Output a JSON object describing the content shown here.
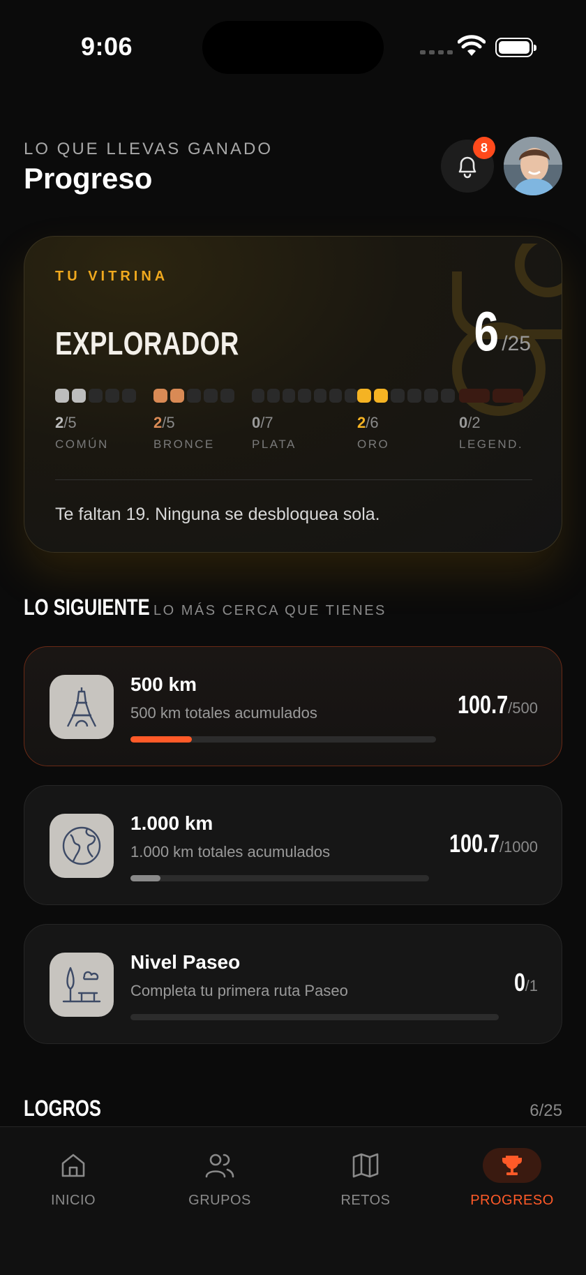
{
  "status_bar": {
    "time": "9:06"
  },
  "header": {
    "eyebrow": "LO QUE LLEVAS GANADO",
    "title": "Progreso",
    "notification_count": "8"
  },
  "vitrina": {
    "eyebrow": "TU VITRINA",
    "title": "EXPLORADOR",
    "count": "6",
    "total": "/25",
    "tiers": [
      {
        "got": "2",
        "max": "/5",
        "name": "COMÚN",
        "color": "#bdbdbd",
        "filled": 2,
        "dots": 5
      },
      {
        "got": "2",
        "max": "/5",
        "name": "BRONCE",
        "color": "#d98a55",
        "filled": 2,
        "dots": 5
      },
      {
        "got": "0",
        "max": "/7",
        "name": "PLATA",
        "color": "#cfcfcf",
        "filled": 0,
        "dots": 7
      },
      {
        "got": "2",
        "max": "/6",
        "name": "ORO",
        "color": "#f5b323",
        "filled": 2,
        "dots": 6
      },
      {
        "got": "0",
        "max": "/2",
        "name": "LEGEND.",
        "color": "#ff5a28",
        "filled": 0,
        "dots": 2
      }
    ],
    "footer": "Te faltan 19. Ninguna se desbloquea sola."
  },
  "siguiente": {
    "title": "LO SIGUIENTE",
    "subtitle": "LO MÁS CERCA QUE TIENES",
    "goals": [
      {
        "title": "500 km",
        "subtitle": "500 km totales acumulados",
        "value": "100.7",
        "max": "/500",
        "progress": 0.201,
        "icon": "eiffel-tower-icon",
        "active": true
      },
      {
        "title": "1.000 km",
        "subtitle": "1.000 km totales acumulados",
        "value": "100.7",
        "max": "/1000",
        "progress": 0.101,
        "icon": "globe-icon",
        "active": false
      },
      {
        "title": "Nivel Paseo",
        "subtitle": "Completa tu primera ruta Paseo",
        "value": "0",
        "max": "/1",
        "progress": 0,
        "icon": "park-tree-icon",
        "active": false
      }
    ]
  },
  "logros": {
    "title": "LOGROS",
    "count": "6/25"
  },
  "tabs": [
    {
      "label": "INICIO",
      "icon": "home-icon"
    },
    {
      "label": "GRUPOS",
      "icon": "users-icon"
    },
    {
      "label": "RETOS",
      "icon": "map-icon"
    },
    {
      "label": "PROGRESO",
      "icon": "trophy-icon",
      "active": true
    }
  ],
  "colors": {
    "accent": "#ff5a28",
    "gold": "#f0a91e",
    "background": "#0b0b0b"
  }
}
